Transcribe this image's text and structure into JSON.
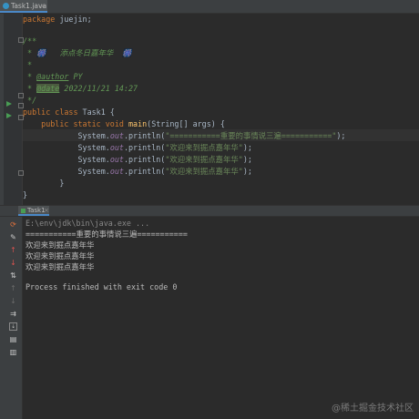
{
  "editor": {
    "tab_label": "Task1.java",
    "tab_close": "×",
    "lines": {
      "package_kw": "package",
      "package_name": " juejin;",
      "doc_open": "/**",
      "doc_title": " * 🎆   添点冬日嘉年华  🎆",
      "doc_star": " *",
      "author_tag": "@author",
      "author_val": " PY",
      "date_tag": "@date",
      "date_val": " 2022/11/21 14:27",
      "doc_close": " */",
      "class_kw": "public class",
      "class_name": " Task1 {",
      "method_kw": "    public static void",
      "method_name": "main",
      "method_rest": "(String[] args) {",
      "sys": "            System.",
      "out": "out",
      "println": ".println(",
      "str1": "\"===========重要的事情说三遍===========\"",
      "str2": "\"欢迎来到掘点嘉年华\"",
      "str3": "\"欢迎来到掘点嘉年华\"",
      "str4": "\"欢迎来到掘点嘉年华\"",
      "end": ");",
      "close_method": "        }",
      "close_class": "}"
    }
  },
  "run_panel": {
    "tab_label": "Task1",
    "tab_close": "×",
    "command": "E:\\env\\jdk\\bin\\java.exe ...",
    "output": [
      "===========重要的事情说三遍===========",
      "欢迎来到掘点嘉年华",
      "欢迎来到掘点嘉年华",
      "欢迎来到掘点嘉年华"
    ],
    "exit_message": "Process finished with exit code 0"
  },
  "toolbar_icons": [
    "rerun-icon",
    "settings-icon",
    "up-arrow-icon",
    "down-arrow-icon",
    "sort-icon",
    "pin-icon",
    "down-icon",
    "wrap-icon",
    "scroll-end-icon",
    "print-icon",
    "trash-icon"
  ],
  "watermark": "@稀土掘金技术社区",
  "colors": {
    "keyword": "#cc7832",
    "string": "#6a8759",
    "doc": "#629755",
    "field": "#9876aa",
    "method": "#ffc66d"
  }
}
